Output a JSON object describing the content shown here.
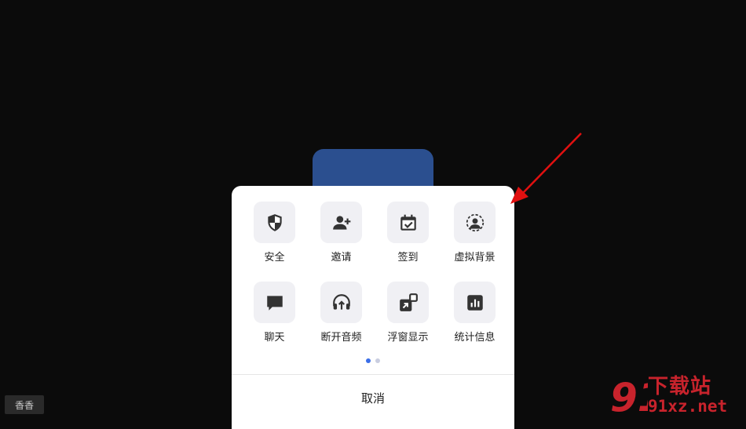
{
  "menu": {
    "items": [
      {
        "label": "安全",
        "icon": "shield-icon"
      },
      {
        "label": "邀请",
        "icon": "add-user-icon"
      },
      {
        "label": "签到",
        "icon": "calendar-check-icon"
      },
      {
        "label": "虚拟背景",
        "icon": "virtual-background-icon"
      },
      {
        "label": "聊天",
        "icon": "chat-bubble-icon"
      },
      {
        "label": "断开音频",
        "icon": "headphones-disconnect-icon"
      },
      {
        "label": "浮窗显示",
        "icon": "floating-window-icon"
      },
      {
        "label": "统计信息",
        "icon": "statistics-icon"
      }
    ],
    "cancel_label": "取消",
    "page_count": 2,
    "current_page": 1
  },
  "participant": {
    "name": "香香"
  },
  "watermark": {
    "brand": "下载站",
    "site": "91xz.net",
    "logo_text": "91"
  },
  "colors": {
    "background": "#0b0b0b",
    "sheet": "#ffffff",
    "icon_tile": "#f0f0f4",
    "accent": "#3a6ee8",
    "avatar_tile": "#2b4f8f",
    "annotation_arrow": "#e01010"
  }
}
